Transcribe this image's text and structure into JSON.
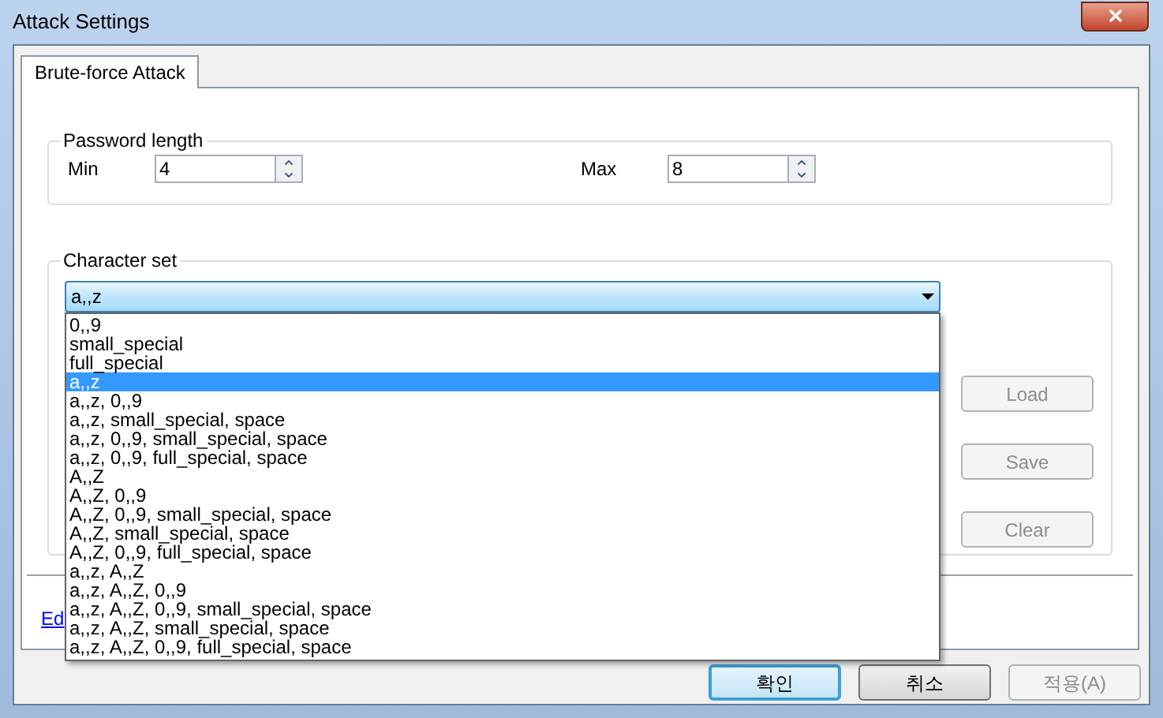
{
  "window": {
    "title": "Attack Settings"
  },
  "tabs": [
    {
      "label": "Brute-force Attack",
      "selected": true
    }
  ],
  "password_length": {
    "title": "Password length",
    "fields": [
      {
        "label": "Min",
        "value": "4"
      },
      {
        "label": "Max",
        "value": "8"
      }
    ]
  },
  "character_set": {
    "title": "Character set",
    "combo_value": "a,,z",
    "options": [
      {
        "label": "0,,9",
        "selected": false
      },
      {
        "label": "small_special",
        "selected": false
      },
      {
        "label": "full_special",
        "selected": false
      },
      {
        "label": "a,,z",
        "selected": true
      },
      {
        "label": "a,,z, 0,,9",
        "selected": false
      },
      {
        "label": "a,,z, small_special, space",
        "selected": false
      },
      {
        "label": "a,,z, 0,,9, small_special, space",
        "selected": false
      },
      {
        "label": "a,,z, 0,,9, full_special, space",
        "selected": false
      },
      {
        "label": "A,,Z",
        "selected": false
      },
      {
        "label": "A,,Z, 0,,9",
        "selected": false
      },
      {
        "label": "A,,Z, 0,,9, small_special, space",
        "selected": false
      },
      {
        "label": "A,,Z, small_special, space",
        "selected": false
      },
      {
        "label": "A,,Z, 0,,9, full_special, space",
        "selected": false
      },
      {
        "label": "a,,z, A,,Z",
        "selected": false
      },
      {
        "label": "a,,z, A,,Z, 0,,9",
        "selected": false
      },
      {
        "label": "a,,z, A,,Z, 0,,9, small_special, space",
        "selected": false
      },
      {
        "label": "a,,z, A,,Z, small_special, space",
        "selected": false
      },
      {
        "label": "a,,z, A,,Z, 0,,9, full_special, space",
        "selected": false
      }
    ],
    "buttons": [
      {
        "label": "Load",
        "disabled": true
      },
      {
        "label": "Save",
        "disabled": true
      },
      {
        "label": "Clear",
        "disabled": true
      }
    ]
  },
  "link": "Ed",
  "dialog_buttons": [
    {
      "label": "확인",
      "focused": true,
      "disabled": false
    },
    {
      "label": "취소",
      "focused": false,
      "disabled": false
    },
    {
      "label": "적용(A)",
      "focused": false,
      "disabled": true
    }
  ]
}
